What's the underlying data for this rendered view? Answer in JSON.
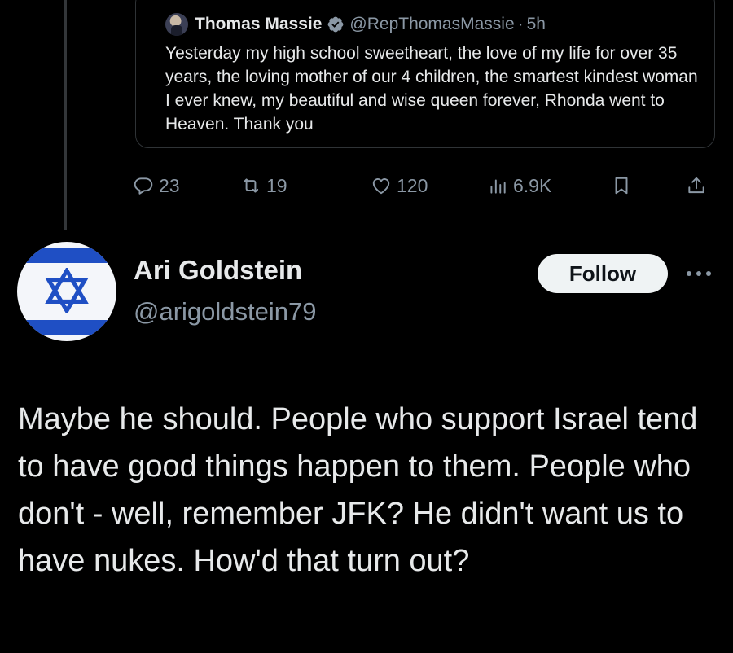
{
  "quoted_tweet": {
    "author_name": "Thomas Massie",
    "handle": "@RepThomasMassie",
    "separator": "·",
    "time": "5h",
    "text": "Yesterday my high school sweetheart, the love of my life for over 35 years, the loving mother of our 4 children, the smartest kindest woman I ever knew, my beautiful and wise queen forever, Rhonda went to Heaven. Thank you"
  },
  "actions": {
    "replies": "23",
    "reposts": "19",
    "likes": "120",
    "views": "6.9K"
  },
  "reply": {
    "author_name": "Ari Goldstein",
    "handle": "@arigoldstein79",
    "follow_label": "Follow",
    "text": "Maybe he should. People who support Israel tend to have good things happen to them. People who don't - well, remember JFK? He didn't want us to have nukes. How'd that turn out?"
  },
  "colors": {
    "background": "#000000",
    "text_primary": "#e7e9ea",
    "text_secondary": "#8b98a5",
    "verified_blue": "#1d9bf0",
    "flag_blue": "#1f4fc4"
  },
  "icons": {
    "reply": "reply-bubble-icon",
    "repost": "repost-icon",
    "like": "heart-icon",
    "views": "views-bars-icon",
    "bookmark": "bookmark-icon",
    "share": "share-icon",
    "verified": "verified-badge-icon",
    "more": "more-dots-icon"
  }
}
